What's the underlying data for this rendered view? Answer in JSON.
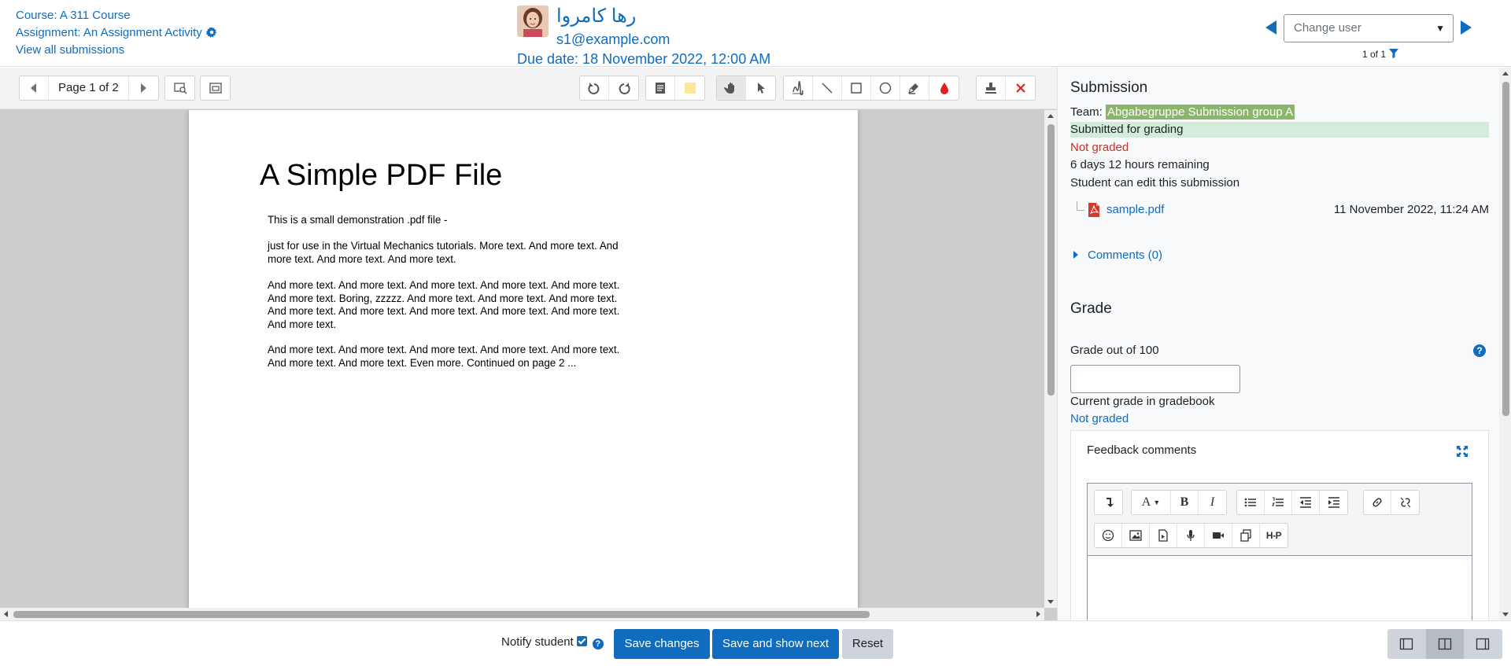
{
  "header": {
    "course_link": "Course: A 311 Course",
    "assignment_link": "Assignment: An Assignment Activity",
    "view_all_link": "View all submissions",
    "user_name": "رها کامروا",
    "user_email": "s1@example.com",
    "due_date": "Due date: 18 November 2022, 12:00 AM",
    "change_user_placeholder": "Change user",
    "user_count": "1 of 1"
  },
  "editor": {
    "page_label": "Page 1 of 2",
    "pdf": {
      "title": "A Simple PDF File",
      "paragraphs": [
        "This is a small demonstration .pdf file -",
        "just for use in the Virtual Mechanics tutorials. More text. And more text. And more text. And more text. And more text.",
        "And more text. And more text. And more text. And more text. And more text. And more text. Boring, zzzzz. And more text. And more text. And more text. And more text. And more text. And more text. And more text. And more text. And more text.",
        "And more text. And more text. And more text. And more text. And more text. And more text. And more text. Even more. Continued on page 2 ..."
      ]
    },
    "toolbar_icons": [
      "prev-page-icon",
      "next-page-icon",
      "search-comments-icon",
      "expand-comments-icon",
      "rotate-left-icon",
      "rotate-right-icon",
      "comment-icon",
      "comment-colour-icon",
      "pan-icon",
      "select-icon",
      "pen-icon",
      "line-icon",
      "rectangle-icon",
      "oval-icon",
      "highlight-icon",
      "annotation-colour-icon",
      "stamp-icon",
      "delete-icon"
    ]
  },
  "submission": {
    "heading": "Submission",
    "team_label": "Team: ",
    "team_name": "Abgabegruppe Submission group A",
    "status_submitted": "Submitted for grading",
    "status_grading": "Not graded",
    "time_remaining": "6 days 12 hours remaining",
    "edit_note": "Student can edit this submission",
    "file_name": "sample.pdf",
    "file_date": "11 November 2022, 11:24 AM",
    "comments_link": "Comments (0)"
  },
  "grade": {
    "heading": "Grade",
    "grade_label": "Grade out of 100",
    "grade_value": "",
    "gradebook_label": "Current grade in gradebook",
    "gradebook_value": "Not graded",
    "feedback_label": "Feedback comments",
    "editor_icons": [
      "collapse-icon",
      "font-icon",
      "bold-icon",
      "italic-icon",
      "bullet-list-icon",
      "numbered-list-icon",
      "outdent-icon",
      "indent-icon",
      "link-icon",
      "unlink-icon",
      "emoji-icon",
      "image-icon",
      "media-icon",
      "record-audio-icon",
      "record-video-icon",
      "manage-files-icon",
      "h5p-icon"
    ],
    "h5p_label": "H-P",
    "bold_label": "B",
    "italic_label": "I",
    "font_label": "A"
  },
  "footer": {
    "notify_label": "Notify student",
    "notify_checked": true,
    "save_label": "Save changes",
    "save_next_label": "Save and show next",
    "reset_label": "Reset"
  },
  "colors": {
    "link": "#0f6cbf",
    "primary_button": "#0f6cbf",
    "not_graded": "#ca3120",
    "submitted_bg": "#d4edda",
    "team_highlight": "#8bb56a"
  }
}
